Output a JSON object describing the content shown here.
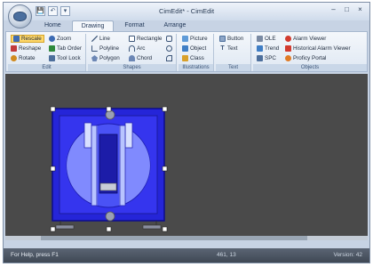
{
  "window": {
    "title": "CimEdit* - CimEdit",
    "quick_access": [
      "💾",
      "↶",
      "▾"
    ],
    "controls": {
      "minimize": "–",
      "maximize": "□",
      "close": "×"
    }
  },
  "tabs": [
    {
      "label": "Home"
    },
    {
      "label": "Drawing"
    },
    {
      "label": "Format"
    },
    {
      "label": "Arrange"
    }
  ],
  "ribbon": {
    "edit": {
      "label": "Edit",
      "items": [
        "Rescale",
        "Zoom",
        "Reshape",
        "Tab Order",
        "Rotate",
        "Tool Lock"
      ]
    },
    "shapes": {
      "label": "Shapes",
      "items": [
        "Line",
        "Rectangle",
        "Polyline",
        "Arc",
        "Polygon",
        "Chord"
      ]
    },
    "illustrations": {
      "label": "Illustrations",
      "items": [
        "Picture",
        "Object",
        "Class"
      ]
    },
    "text": {
      "label": "Text",
      "items": [
        "Button",
        "Text"
      ]
    },
    "objects": {
      "label": "Objects",
      "items": [
        "OLE",
        "Alarm Viewer",
        "Trend",
        "Historical Alarm Viewer",
        "SPC",
        "Proficy Portal"
      ]
    }
  },
  "statusbar": {
    "help": "For Help, press F1",
    "coords": "461, 13",
    "version": "Version: 42"
  },
  "colors": {
    "canvas_bg": "#4a4a4a",
    "object_blue": "#2222dd",
    "selection_handle": "#ffffff",
    "ribbon_bg": "#e6edf6",
    "statusbar_bg": "#4a5361"
  }
}
